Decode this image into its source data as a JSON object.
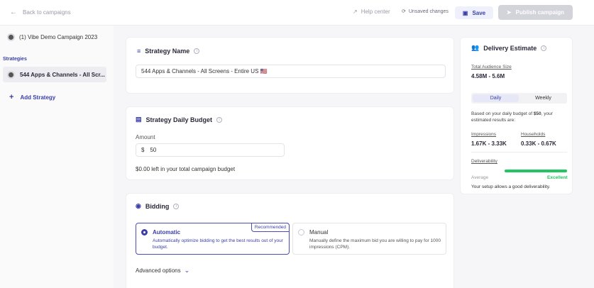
{
  "topbar": {
    "back_label": "Back to campaigns",
    "help_label": "Help center",
    "unsaved_label": "Unsaved changes",
    "save_label": "Save",
    "publish_label": "Publish campaign"
  },
  "sidebar": {
    "campaign_name": "(1) Vibe Demo Campaign 2023",
    "strategies_heading": "Strategies",
    "strategy_item": "544 Apps & Channels - All Scr...",
    "add_strategy_label": "Add Strategy"
  },
  "strategy_name": {
    "title": "Strategy Name",
    "value": "544 Apps & Channels - All Screens - Entire US 🇺🇸"
  },
  "budget": {
    "title": "Strategy Daily Budget",
    "amount_label": "Amount",
    "currency": "$",
    "amount_value": "50",
    "remaining_text": "$0.00 left in your total campaign budget"
  },
  "bidding": {
    "title": "Bidding",
    "automatic": {
      "title": "Automatic",
      "desc": "Automatically optimize bidding to get the best results out of your budget.",
      "badge": "Recommended"
    },
    "manual": {
      "title": "Manual",
      "desc": "Manually define the maximum bid you are willing to pay for 1000 impressions (CPM)."
    },
    "advanced_label": "Advanced options"
  },
  "estimate": {
    "title": "Delivery Estimate",
    "audience_label": "Total Audience Size",
    "audience_value": "4.58M - 5.6M",
    "tab_daily": "Daily",
    "tab_weekly": "Weekly",
    "note_prefix": "Based on your daily budget of ",
    "note_budget": "$50",
    "note_suffix": ", your estimated results are:",
    "impressions_label": "Impressions",
    "impressions_value": "1.67K - 3.33K",
    "households_label": "Households",
    "households_value": "0.33K - 0.67K",
    "deliverability_label": "Deliverability",
    "avg_label": "Average",
    "excellent_label": "Excellent",
    "deliverability_level": 1.0,
    "footer_note": "Your setup allows a good deliverability."
  },
  "colors": {
    "accent": "#3b3fa6",
    "success": "#22c55e",
    "publish_disabled": "#d3d3da"
  }
}
